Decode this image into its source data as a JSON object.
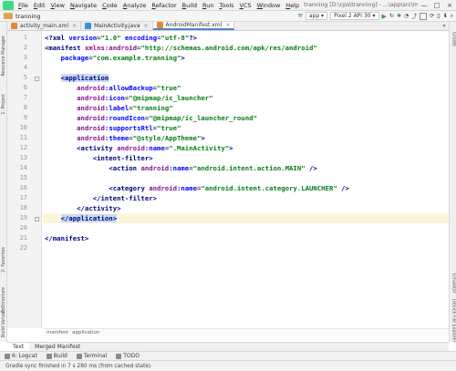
{
  "window": {
    "title": "tranning [D:\\cps\\tranning] - ...\\app\\src\\main\\AndroidManifest.xml [app]",
    "controls": [
      "—",
      "□",
      "×"
    ]
  },
  "menu": {
    "items": [
      {
        "u": "F",
        "rest": "ile"
      },
      {
        "u": "E",
        "rest": "dit"
      },
      {
        "u": "V",
        "rest": "iew"
      },
      {
        "u": "N",
        "rest": "avigate"
      },
      {
        "u": "C",
        "rest": "ode"
      },
      {
        "u": "A",
        "rest": "nalyze"
      },
      {
        "u": "R",
        "rest": "efactor"
      },
      {
        "u": "B",
        "rest": "uild"
      },
      {
        "u": "R",
        "rest": "un"
      },
      {
        "u": "T",
        "rest": "ools"
      },
      {
        "u": "V",
        "rest": "CS"
      },
      {
        "u": "W",
        "rest": "indow"
      },
      {
        "u": "H",
        "rest": "elp"
      }
    ]
  },
  "nav": {
    "project": "tranning",
    "run_config": "app",
    "device": "Pixel 2 API 30"
  },
  "tabs": [
    {
      "label": "activity_main.xml",
      "color": "#e0883a",
      "active": false
    },
    {
      "label": "MainActivity.java",
      "color": "#3c8fd6",
      "active": false
    },
    {
      "label": "AndroidManifest.xml",
      "color": "#e0883a",
      "active": true
    }
  ],
  "left_tool_windows": [
    "1: Project",
    "Resource Manager",
    "2: Favorites",
    "Z: Structure",
    "Build Variants"
  ],
  "right_tool_windows": [
    "Gradle",
    "Emulator",
    "Device File Explorer"
  ],
  "editor": {
    "line_numbers": [
      "1",
      "2",
      "3",
      "4",
      "5",
      "6",
      "7",
      "8",
      "9",
      "10",
      "11",
      "12",
      "13",
      "14",
      "15",
      "16",
      "17",
      "18",
      "19",
      "20",
      "21",
      "22"
    ],
    "current_line": 19,
    "lines": [
      {
        "indent": "",
        "tokens": [
          [
            "decl",
            "<?xml "
          ],
          [
            "attr",
            "version"
          ],
          [
            "punct",
            "="
          ],
          [
            "str",
            "\"1.0\""
          ],
          [
            "punct",
            " "
          ],
          [
            "attr",
            "encoding"
          ],
          [
            "punct",
            "="
          ],
          [
            "str",
            "\"utf-8\""
          ],
          [
            "decl",
            "?>"
          ]
        ]
      },
      {
        "indent": "",
        "tokens": [
          [
            "tag",
            "<manifest "
          ],
          [
            "ns",
            "xmlns:android"
          ],
          [
            "punct",
            "="
          ],
          [
            "str",
            "\"http://schemas.android.com/apk/res/android\""
          ]
        ]
      },
      {
        "indent": "    ",
        "tokens": [
          [
            "attr",
            "package"
          ],
          [
            "punct",
            "="
          ],
          [
            "str",
            "\"com.example.tranning\""
          ],
          [
            "tag",
            ">"
          ]
        ]
      },
      {
        "indent": "",
        "tokens": []
      },
      {
        "indent": "    ",
        "tokens": [
          [
            "tag-hl",
            "<application"
          ]
        ]
      },
      {
        "indent": "        ",
        "tokens": [
          [
            "ns",
            "android"
          ],
          [
            "attr",
            ":allowBackup"
          ],
          [
            "punct",
            "="
          ],
          [
            "str",
            "\"true\""
          ]
        ]
      },
      {
        "indent": "        ",
        "tokens": [
          [
            "ns",
            "android"
          ],
          [
            "attr",
            ":icon"
          ],
          [
            "punct",
            "="
          ],
          [
            "str",
            "\"@mipmap/ic_launcher\""
          ]
        ]
      },
      {
        "indent": "        ",
        "tokens": [
          [
            "ns",
            "android"
          ],
          [
            "attr",
            ":label"
          ],
          [
            "punct",
            "="
          ],
          [
            "str",
            "\"tranning\""
          ]
        ]
      },
      {
        "indent": "        ",
        "tokens": [
          [
            "ns",
            "android"
          ],
          [
            "attr",
            ":roundIcon"
          ],
          [
            "punct",
            "="
          ],
          [
            "str",
            "\"@mipmap/ic_launcher_round\""
          ]
        ]
      },
      {
        "indent": "        ",
        "tokens": [
          [
            "ns",
            "android"
          ],
          [
            "attr",
            ":supportsRtl"
          ],
          [
            "punct",
            "="
          ],
          [
            "str",
            "\"true\""
          ]
        ]
      },
      {
        "indent": "        ",
        "tokens": [
          [
            "ns",
            "android"
          ],
          [
            "attr",
            ":theme"
          ],
          [
            "punct",
            "="
          ],
          [
            "str",
            "\"@style/AppTheme\""
          ],
          [
            "tag",
            ">"
          ]
        ]
      },
      {
        "indent": "        ",
        "tokens": [
          [
            "tag",
            "<activity "
          ],
          [
            "ns",
            "android"
          ],
          [
            "attr",
            ":name"
          ],
          [
            "punct",
            "="
          ],
          [
            "str",
            "\".MainActivity\""
          ],
          [
            "tag",
            ">"
          ]
        ]
      },
      {
        "indent": "            ",
        "tokens": [
          [
            "tag",
            "<intent-filter>"
          ]
        ]
      },
      {
        "indent": "                ",
        "tokens": [
          [
            "tag",
            "<action "
          ],
          [
            "ns",
            "android"
          ],
          [
            "attr",
            ":name"
          ],
          [
            "punct",
            "="
          ],
          [
            "str",
            "\"android.intent.action.MAIN\""
          ],
          [
            "tag",
            " />"
          ]
        ]
      },
      {
        "indent": "",
        "tokens": []
      },
      {
        "indent": "                ",
        "tokens": [
          [
            "tag",
            "<category "
          ],
          [
            "ns",
            "android"
          ],
          [
            "attr",
            ":name"
          ],
          [
            "punct",
            "="
          ],
          [
            "str",
            "\"android.intent.category.LAUNCHER\""
          ],
          [
            "tag",
            " />"
          ]
        ]
      },
      {
        "indent": "            ",
        "tokens": [
          [
            "tag",
            "</intent-filter>"
          ]
        ]
      },
      {
        "indent": "        ",
        "tokens": [
          [
            "tag",
            "</activity>"
          ]
        ]
      },
      {
        "indent": "    ",
        "tokens": [
          [
            "tag-hl",
            "</application>"
          ]
        ]
      },
      {
        "indent": "",
        "tokens": []
      },
      {
        "indent": "",
        "tokens": [
          [
            "tag",
            "</manifest>"
          ]
        ]
      },
      {
        "indent": "",
        "tokens": []
      }
    ]
  },
  "breadcrumb": [
    "manifest",
    "application"
  ],
  "view_tabs": [
    {
      "label": "Text",
      "active": true
    },
    {
      "label": "Merged Manifest",
      "active": false
    }
  ],
  "bottom_tools": [
    {
      "label": "6: Logcat",
      "icon": "logcat-icon"
    },
    {
      "label": "Build",
      "icon": "build-icon"
    },
    {
      "label": "Terminal",
      "icon": "terminal-icon"
    },
    {
      "label": "TODO",
      "icon": "todo-icon"
    }
  ],
  "status": {
    "message": "Gradle sync finished in 7 s 280 ms (from cached state)"
  }
}
